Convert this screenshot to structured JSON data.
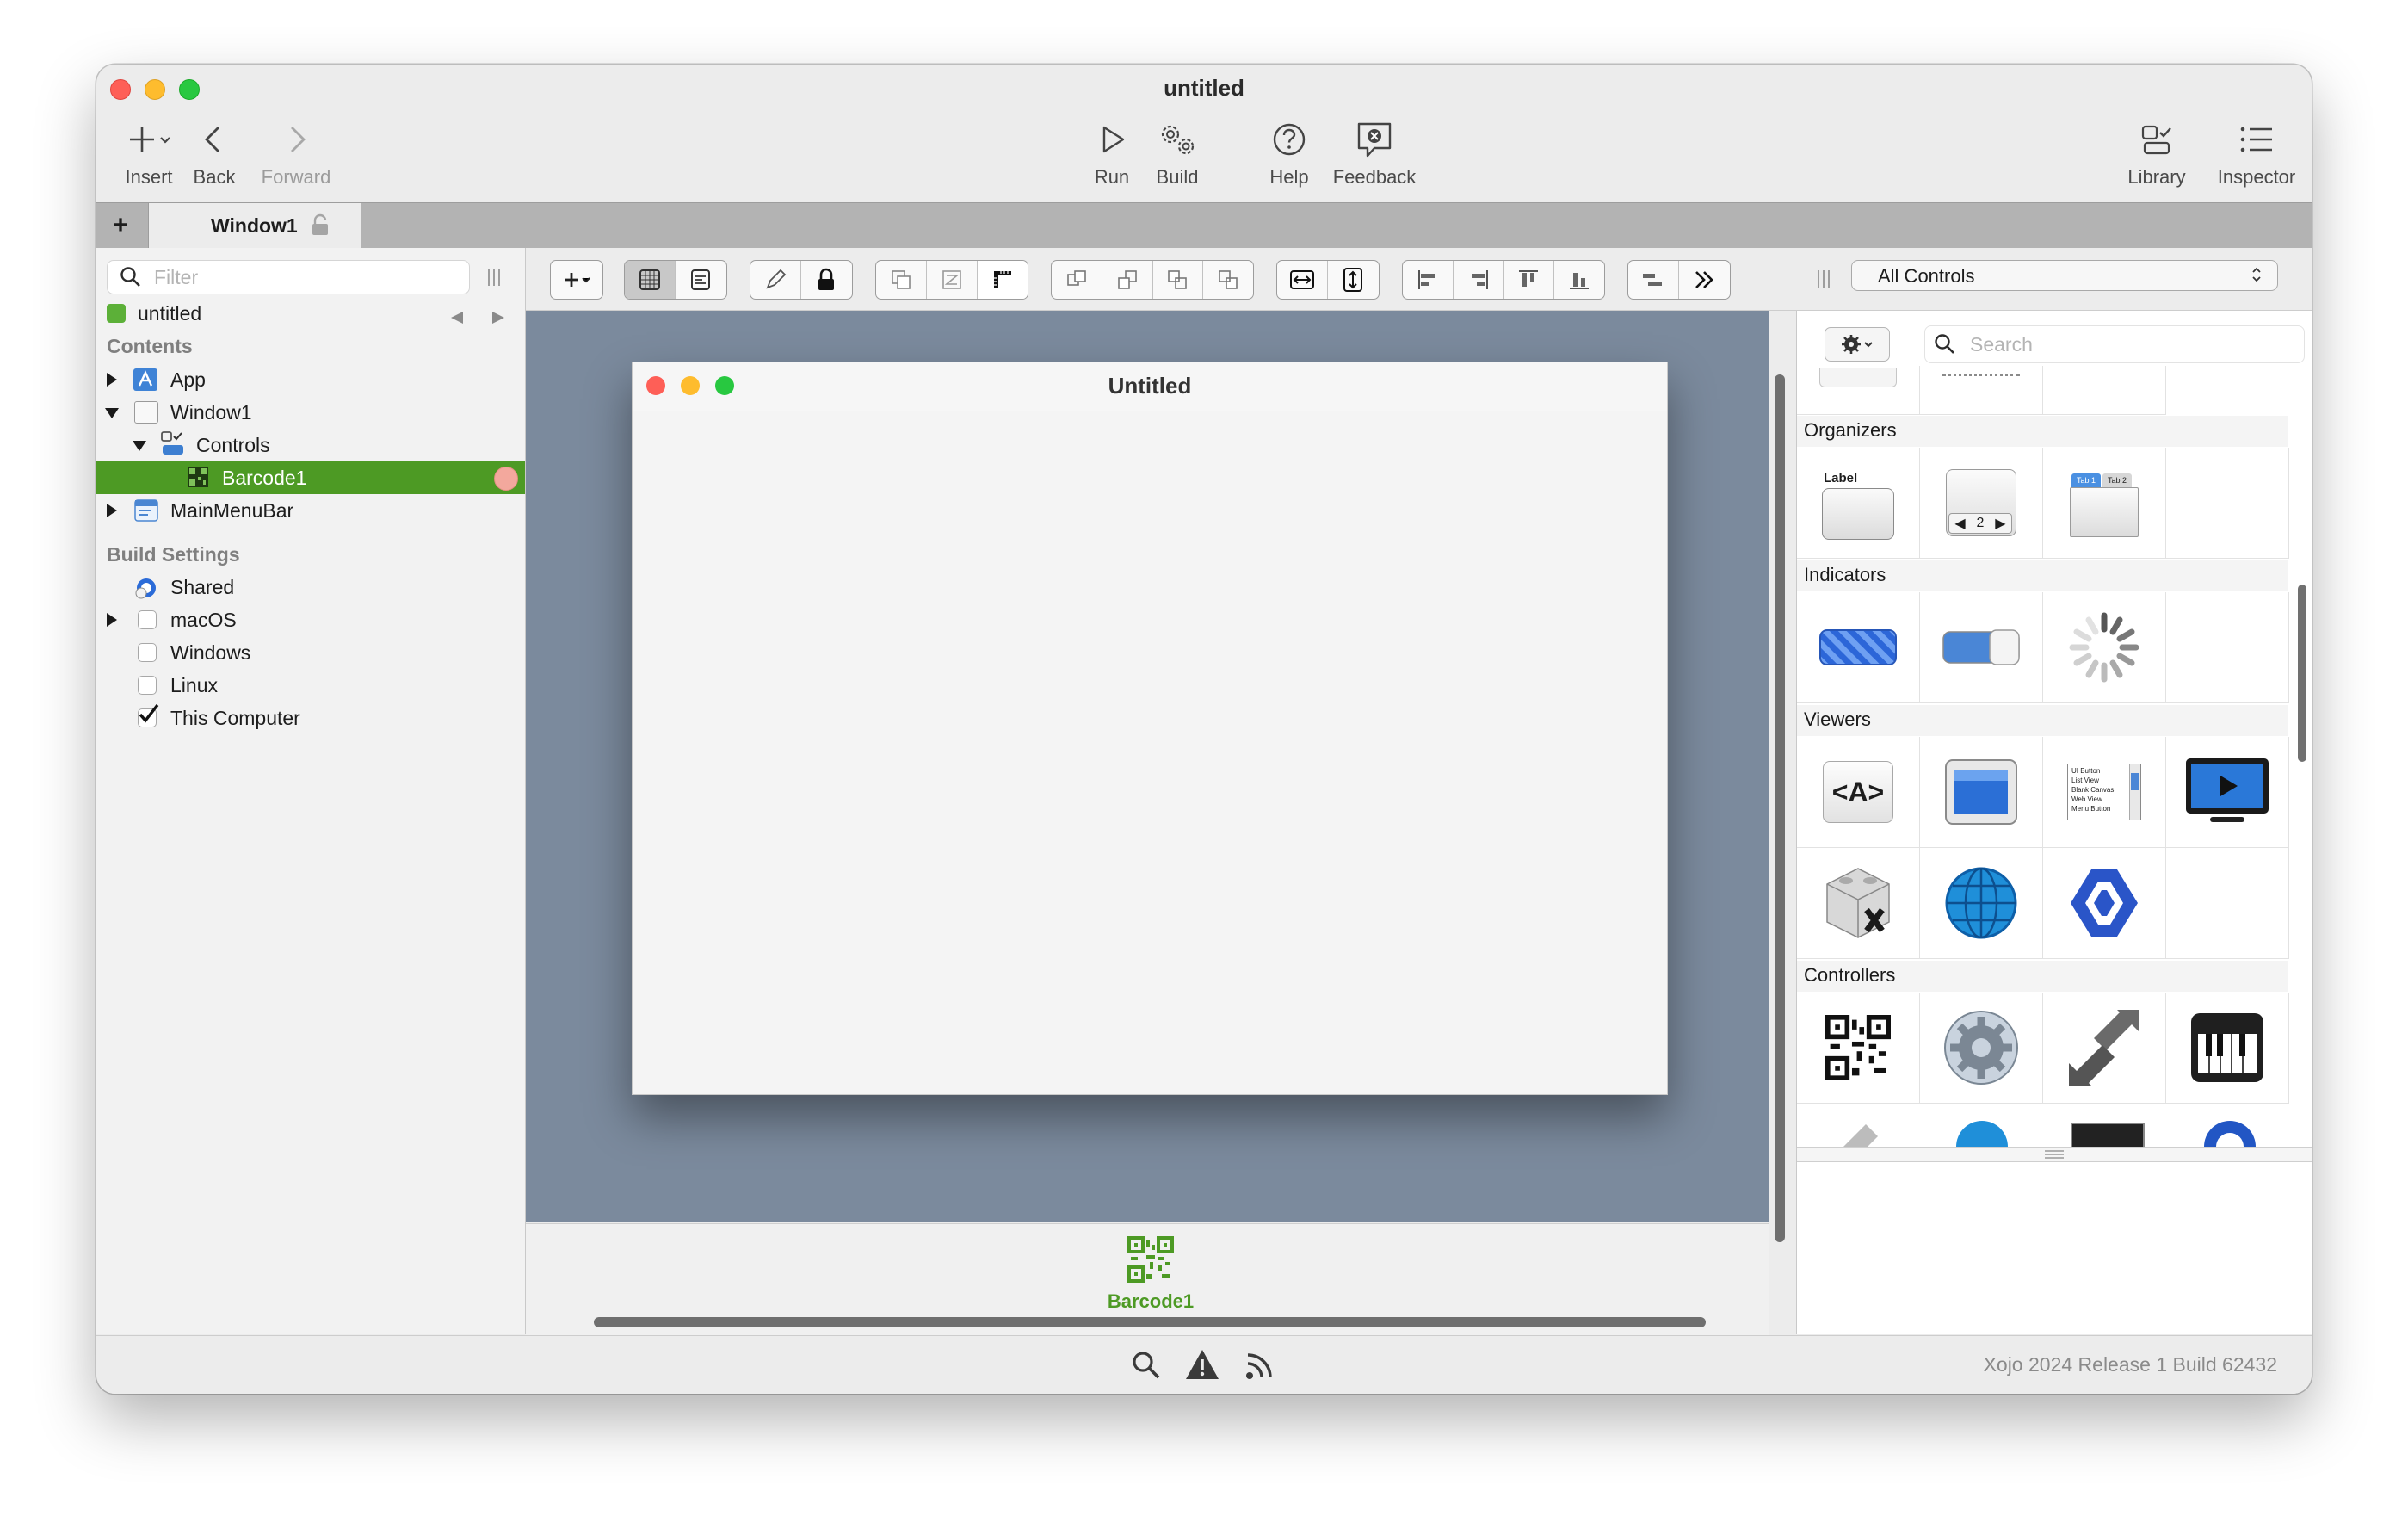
{
  "window": {
    "title": "untitled"
  },
  "toolbar": {
    "insert": "Insert",
    "back": "Back",
    "forward": "Forward",
    "run": "Run",
    "build": "Build",
    "help": "Help",
    "feedback": "Feedback",
    "library": "Library",
    "inspector": "Inspector"
  },
  "tabs": [
    {
      "label": "Window1",
      "locked": true
    }
  ],
  "sidebar": {
    "filter_placeholder": "Filter",
    "project": "untitled",
    "contents_header": "Contents",
    "items": [
      {
        "label": "App",
        "icon": "app-icon"
      },
      {
        "label": "Window1",
        "icon": "window-icon"
      },
      {
        "label": "Controls",
        "icon": "controls-icon"
      },
      {
        "label": "Barcode1",
        "icon": "qr-code-icon",
        "selected": true
      },
      {
        "label": "MainMenuBar",
        "icon": "menubar-icon"
      }
    ],
    "build_header": "Build Settings",
    "build": [
      {
        "label": "Shared",
        "checked": false
      },
      {
        "label": "macOS",
        "checked": false
      },
      {
        "label": "Windows",
        "checked": false
      },
      {
        "label": "Linux",
        "checked": false
      },
      {
        "label": "This Computer",
        "checked": true
      }
    ]
  },
  "design_window": {
    "title": "Untitled"
  },
  "tray": {
    "item_label": "Barcode1"
  },
  "library": {
    "filter": "All Controls",
    "search_placeholder": "Search",
    "groups": [
      {
        "name": "Organizers",
        "items": [
          "Label",
          "2",
          "Tab 1",
          "Tab 2"
        ]
      },
      {
        "name": "Indicators"
      },
      {
        "name": "Viewers",
        "items": [
          "<A>",
          "UI Button",
          "List View",
          "Blank Canvas",
          "Web View",
          "Menu Button"
        ]
      },
      {
        "name": "Controllers"
      }
    ]
  },
  "status": {
    "version": "Xojo 2024 Release 1 Build 62432"
  },
  "colors": {
    "selection": "#4d9a24",
    "canvas": "#7b8a9d",
    "tray_label": "#4d9a24"
  }
}
